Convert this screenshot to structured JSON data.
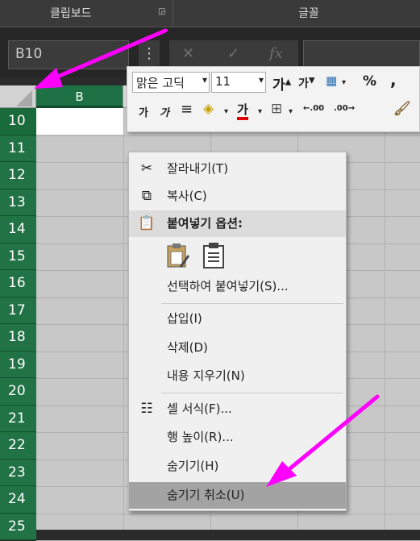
{
  "ribbon": {
    "clipboard_label": "클립보드",
    "font_label": "글꼴"
  },
  "formula_bar": {
    "name_box": "B10",
    "more_icon": "⋮",
    "cancel_icon": "✕",
    "enter_icon": "✓",
    "fx_label": "fx",
    "formula_value": ""
  },
  "grid": {
    "selected_column": "B",
    "row_numbers": [
      "10",
      "11",
      "12",
      "13",
      "14",
      "15",
      "16",
      "17",
      "18",
      "19",
      "20",
      "21",
      "22",
      "23",
      "24",
      "25"
    ],
    "selected_row": "10"
  },
  "mini_toolbar": {
    "font_name": "맑은 고딕",
    "font_size": "11",
    "grow_font": "가",
    "shrink_font": "가",
    "percent": "%",
    "comma": ",",
    "bold": "가",
    "italic": "가",
    "font_color_glyph": "가",
    "inc_decimal": ".00",
    "dec_decimal": ".00"
  },
  "context_menu": {
    "items": [
      {
        "label": "잘라내기(T)",
        "icon": "scissors-icon"
      },
      {
        "label": "복사(C)",
        "icon": "copy-icon"
      },
      {
        "label": "붙여넣기 옵션:",
        "icon": "paste-icon"
      },
      {
        "label": "선택하여 붙여넣기(S)..."
      },
      {
        "label": "삽입(I)"
      },
      {
        "label": "삭제(D)"
      },
      {
        "label": "내용 지우기(N)"
      },
      {
        "label": "셀 서식(F)...",
        "icon": "format-cells-icon"
      },
      {
        "label": "행 높이(R)..."
      },
      {
        "label": "숨기기(H)"
      },
      {
        "label": "숨기기 취소(U)"
      }
    ],
    "hovered_item": "숨기기 취소(U)"
  },
  "colors": {
    "row_header_green": "#217346",
    "annotation_arrow": "#ff00ff",
    "menu_hover": "#a3a3a3"
  }
}
